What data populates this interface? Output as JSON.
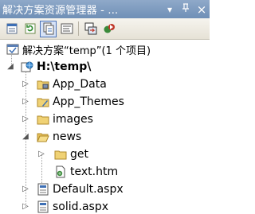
{
  "window": {
    "title": "解决方案资源管理器 - ...",
    "pin_glyph": "▾",
    "autohide_glyph": "ꟼ",
    "close_glyph": "×"
  },
  "toolbar": {
    "buttons": [
      {
        "icon": "properties-icon",
        "active": false
      },
      {
        "icon": "refresh-icon",
        "active": false
      },
      {
        "icon": "nest-related-files-icon",
        "active": true
      },
      {
        "icon": "view-code-icon",
        "active": false
      },
      {
        "icon": "copy-website-icon",
        "active": false
      },
      {
        "icon": "asp-net-configuration-icon",
        "active": false
      }
    ]
  },
  "tree": {
    "solution_label": "解决方案“temp”(1 个项目)",
    "project_label": "H:\\temp\\",
    "items": [
      {
        "label": "App_Data",
        "icon": "app-data-folder-icon"
      },
      {
        "label": "App_Themes",
        "icon": "app-themes-folder-icon"
      },
      {
        "label": "images",
        "icon": "folder-icon"
      },
      {
        "label": "news",
        "icon": "open-folder-icon"
      },
      {
        "label": "get",
        "icon": "folder-icon"
      },
      {
        "label": "text.htm",
        "icon": "html-file-icon"
      },
      {
        "label": "Default.aspx",
        "icon": "aspx-file-icon"
      },
      {
        "label": "solid.aspx",
        "icon": "aspx-file-icon"
      }
    ]
  }
}
